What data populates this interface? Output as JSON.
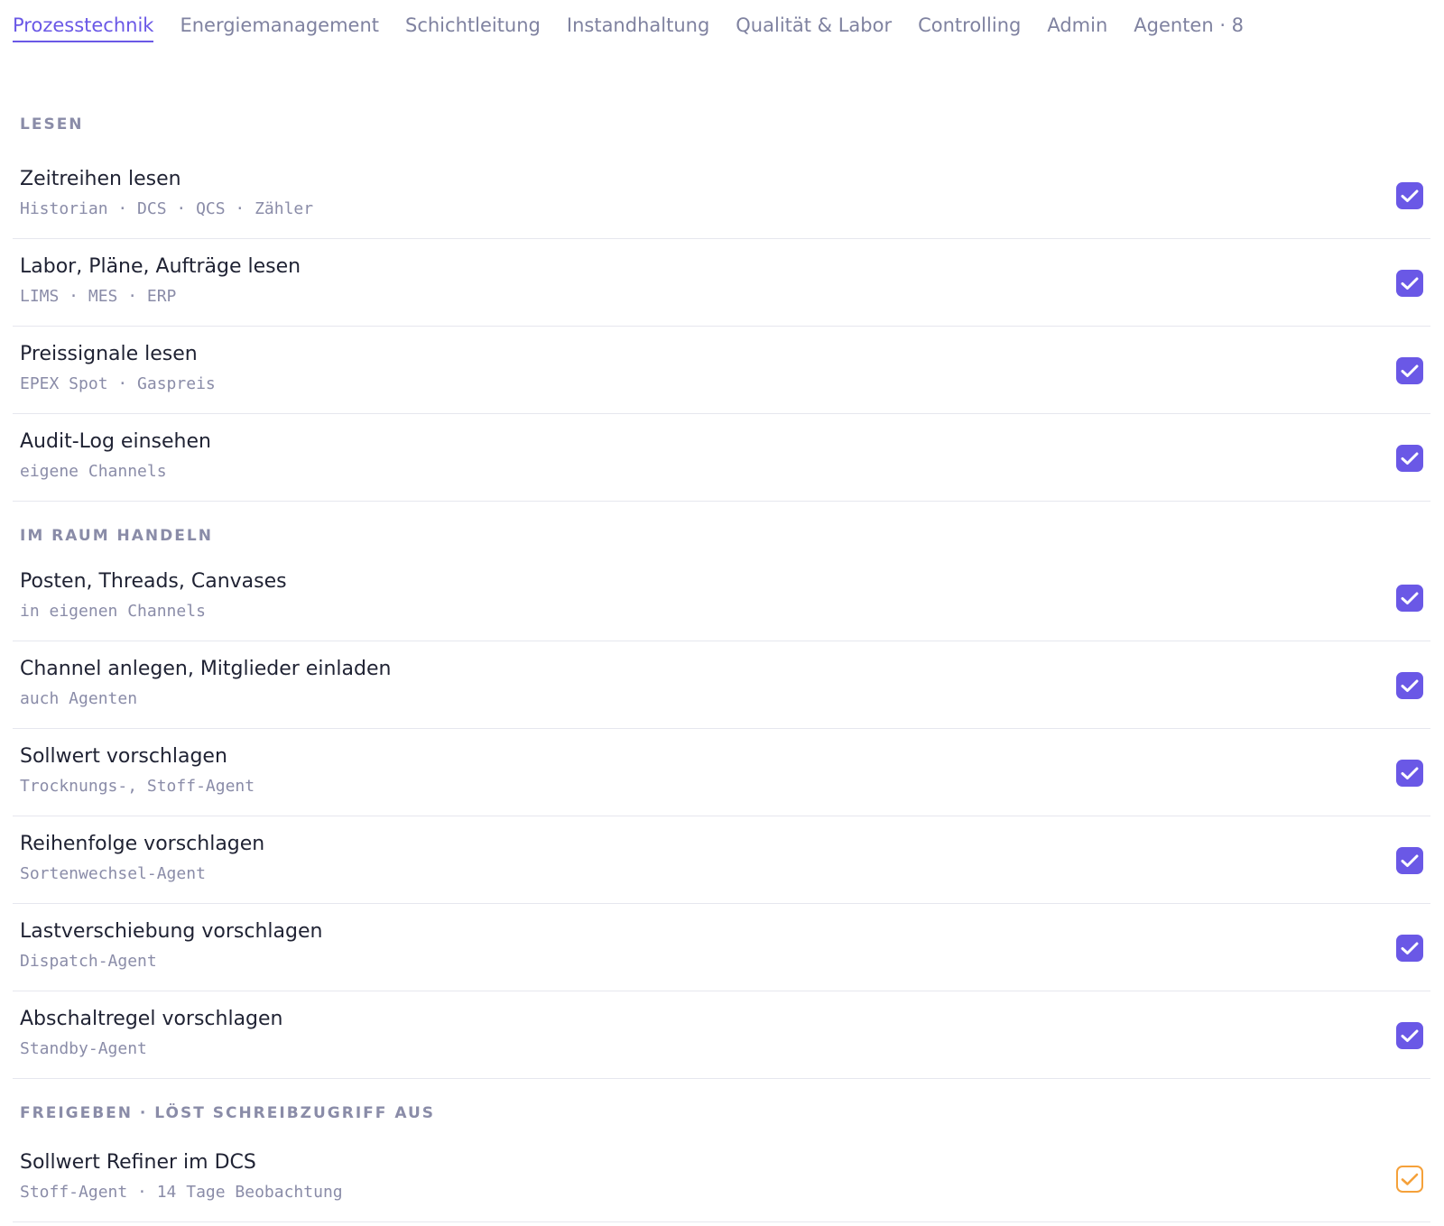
{
  "tabs": [
    {
      "label": "Prozesstechnik",
      "active": true
    },
    {
      "label": "Energiemanagement",
      "active": false
    },
    {
      "label": "Schichtleitung",
      "active": false
    },
    {
      "label": "Instandhaltung",
      "active": false
    },
    {
      "label": "Qualität & Labor",
      "active": false
    },
    {
      "label": "Controlling",
      "active": false
    },
    {
      "label": "Admin",
      "active": false
    },
    {
      "label": "Agenten · 8",
      "active": false
    }
  ],
  "sections": [
    {
      "title": "LESEN",
      "rows": [
        {
          "title": "Zeitreihen lesen",
          "sub": "Historian · DCS · QCS · Zähler",
          "checked": true
        },
        {
          "title": "Labor, Pläne, Aufträge lesen",
          "sub": "LIMS · MES · ERP",
          "checked": true
        },
        {
          "title": "Preissignale lesen",
          "sub": "EPEX Spot · Gaspreis",
          "checked": true
        },
        {
          "title": "Audit-Log einsehen",
          "sub": "eigene Channels",
          "checked": true
        }
      ]
    },
    {
      "title": "IM RAUM HANDELN",
      "rows": [
        {
          "title": "Posten, Threads, Canvases",
          "sub": "in eigenen Channels",
          "checked": true
        },
        {
          "title": "Channel anlegen, Mitglieder einladen",
          "sub": "auch Agenten",
          "checked": true
        },
        {
          "title": "Sollwert vorschlagen",
          "sub": "Trocknungs-, Stoff-Agent",
          "checked": true
        },
        {
          "title": "Reihenfolge vorschlagen",
          "sub": "Sortenwechsel-Agent",
          "checked": true
        },
        {
          "title": "Lastverschiebung vorschlagen",
          "sub": "Dispatch-Agent",
          "checked": true
        },
        {
          "title": "Abschaltregel vorschlagen",
          "sub": "Standby-Agent",
          "checked": true
        }
      ]
    },
    {
      "title": "FREIGEBEN · LÖST SCHREIBZUGRIFF AUS",
      "rows": [
        {
          "title": "Sollwert Refiner im DCS",
          "sub": "Stoff-Agent · 14 Tage Beobachtung",
          "checked": true,
          "pending": true
        }
      ]
    }
  ],
  "colors": {
    "accent": "#6a58e6",
    "warning": "#f5a13a",
    "muted": "#8a8ca8"
  },
  "icons": {
    "check": "checkmark-icon"
  }
}
